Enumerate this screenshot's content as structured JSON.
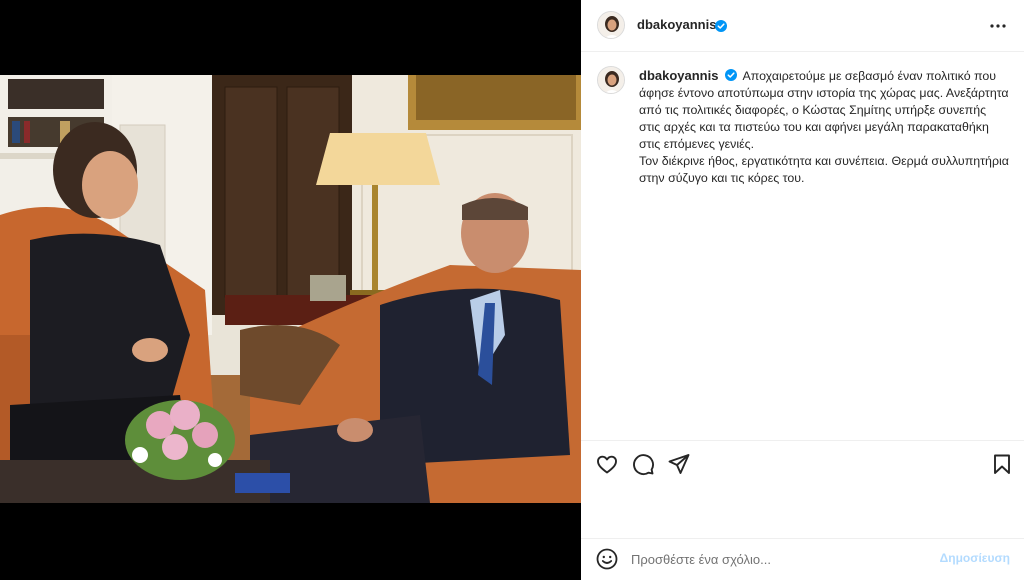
{
  "post": {
    "username": "dbakoyannis",
    "caption": "Αποχαιρετούμε με σεβασμό έναν πολιτικό που άφησε έντονο αποτύπωμα στην ιστορία της χώρας μας. Ανεξάρτητα από τις πολιτικές διαφορές, ο Κώστας Σημίτης υπήρξε συνεπής στις αρχές και τα πιστεύω του και αφήνει μεγάλη παρακαταθήκη στις επόμενες γενιές.\nΤον διέκρινε ήθος, εργατικότητα και συνέπεια. Θερμά συλλυπητήρια στην σύζυγο και τις κόρες του."
  },
  "comment": {
    "placeholder": "Προσθέστε ένα σχόλιο...",
    "post_label": "Δημοσίευση"
  },
  "icons": {
    "more": "more-options-icon",
    "like": "heart-icon",
    "comment": "comment-bubble-icon",
    "share": "paper-plane-icon",
    "save": "bookmark-icon",
    "emoji": "smiley-face-icon",
    "verified": "verified-badge-icon"
  },
  "colors": {
    "verified": "#0095f6",
    "post_button_disabled": "#b3dbff",
    "text": "#262626",
    "muted": "#737373"
  }
}
